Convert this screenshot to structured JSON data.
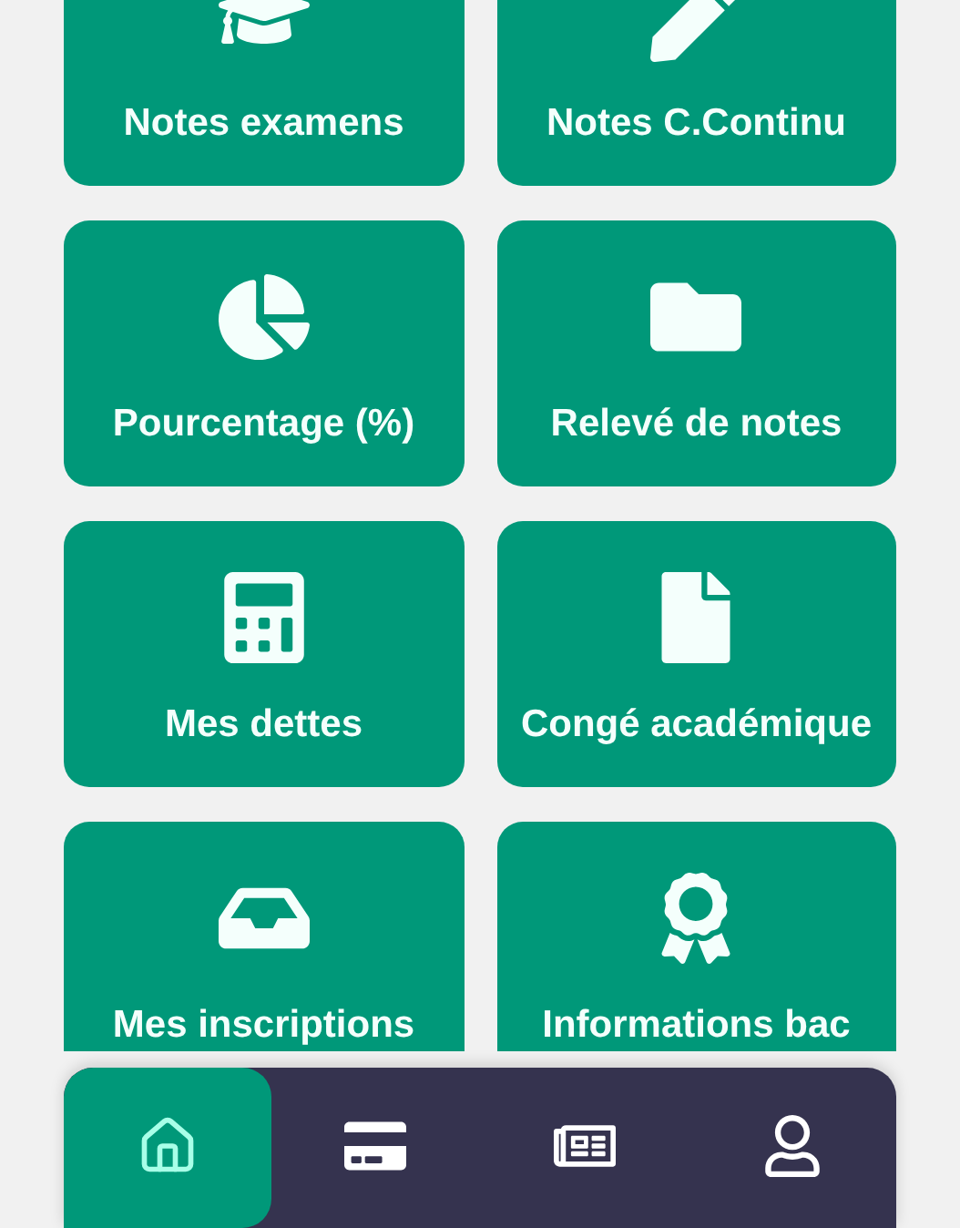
{
  "tiles": [
    {
      "label": "Notes examens"
    },
    {
      "label": "Notes C.Continu"
    },
    {
      "label": "Pourcentage (%)"
    },
    {
      "label": "Relevé de notes"
    },
    {
      "label": "Mes dettes"
    },
    {
      "label": "Congé académique"
    },
    {
      "label": "Mes inscriptions"
    },
    {
      "label": "Informations bac"
    }
  ],
  "bottom_nav": [
    {
      "selected": true
    },
    {
      "selected": false
    },
    {
      "selected": false
    },
    {
      "selected": false
    }
  ]
}
